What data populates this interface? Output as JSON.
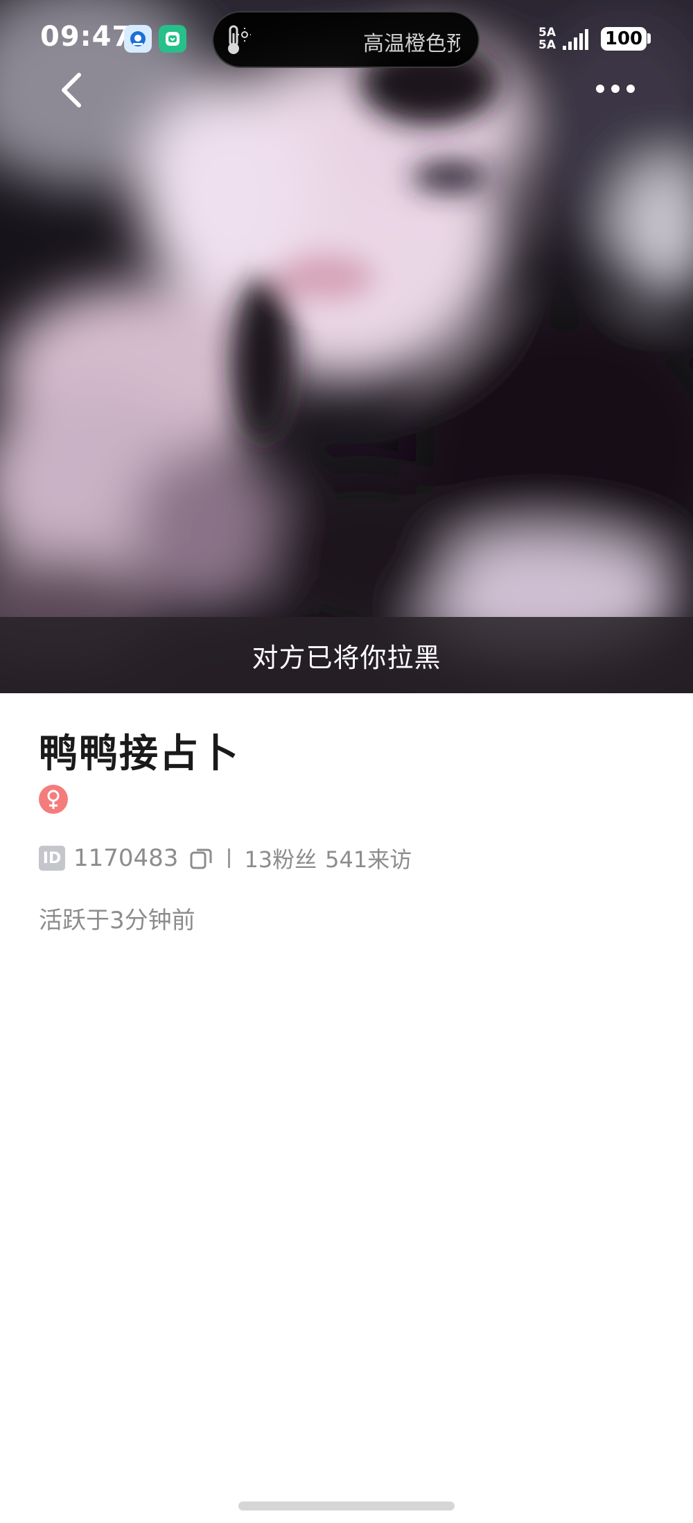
{
  "status_bar": {
    "time": "09:47",
    "pill_text": "高温橙色预",
    "network_top": "5A",
    "network_bottom": "5A",
    "battery": "100"
  },
  "icons": {
    "back": "chevron-left-icon",
    "more": "more-horizontal-icon",
    "thermometer": "thermometer-icon",
    "copy": "copy-icon",
    "gender": "female-icon"
  },
  "hero": {
    "blocked_text": "对方已将你拉黑"
  },
  "profile": {
    "name": "鸭鸭接占卜",
    "gender_symbol": "♀",
    "id_label": "ID",
    "id_number": "1170483",
    "fans": "13粉丝",
    "visits": "541来访",
    "active": "活跃于3分钟前"
  },
  "colors": {
    "gender_badge": "#f57c7c",
    "secondary_text": "#8c8c8c",
    "name_text": "#1a1a1a"
  }
}
